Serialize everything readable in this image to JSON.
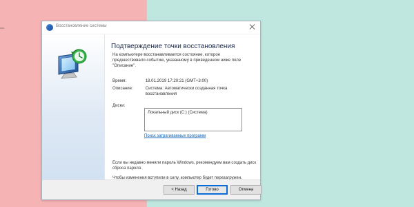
{
  "window": {
    "title": "Восстановление системы"
  },
  "page": {
    "heading": "Подтверждение точки восстановления",
    "intro": "На компьютере восстанавливается состояние, которое предшествовало событию, указанному в приведенном ниже поле \"Описание\".",
    "time_label": "Время:",
    "time_value": "18.01.2019 17:20:21 (GMT+3:00)",
    "desc_label": "Описание:",
    "desc_value": "Система: Автоматически созданная точка восстановления",
    "disks_label": "Диски:",
    "disks_items": [
      "Локальный диск (C:) (Система)"
    ],
    "link_affected": "Поиск затрагиваемых программ",
    "note1": "Если вы недавно меняли пароль Windows, рекомендуем вам создать диск сброса пароля.",
    "note2": "Чтобы изменения вступили в силу, компьютер будет перезагружен. Прежде чем продолжить, сохраните все открытые файлы и закройте все программы."
  },
  "buttons": {
    "back": "< Назад",
    "finish": "Готово",
    "cancel": "Отмена"
  },
  "colors": {
    "bg_left": "#f6b3b3",
    "bg_right": "#bfe7e0",
    "heading": "#1d2a49",
    "link": "#0b64c0",
    "primary_border": "#0a6ad6"
  },
  "icons": {
    "title_icon": "system-restore-icon",
    "side_art": "restore-monitor-clock-icon",
    "close": "close-icon"
  }
}
